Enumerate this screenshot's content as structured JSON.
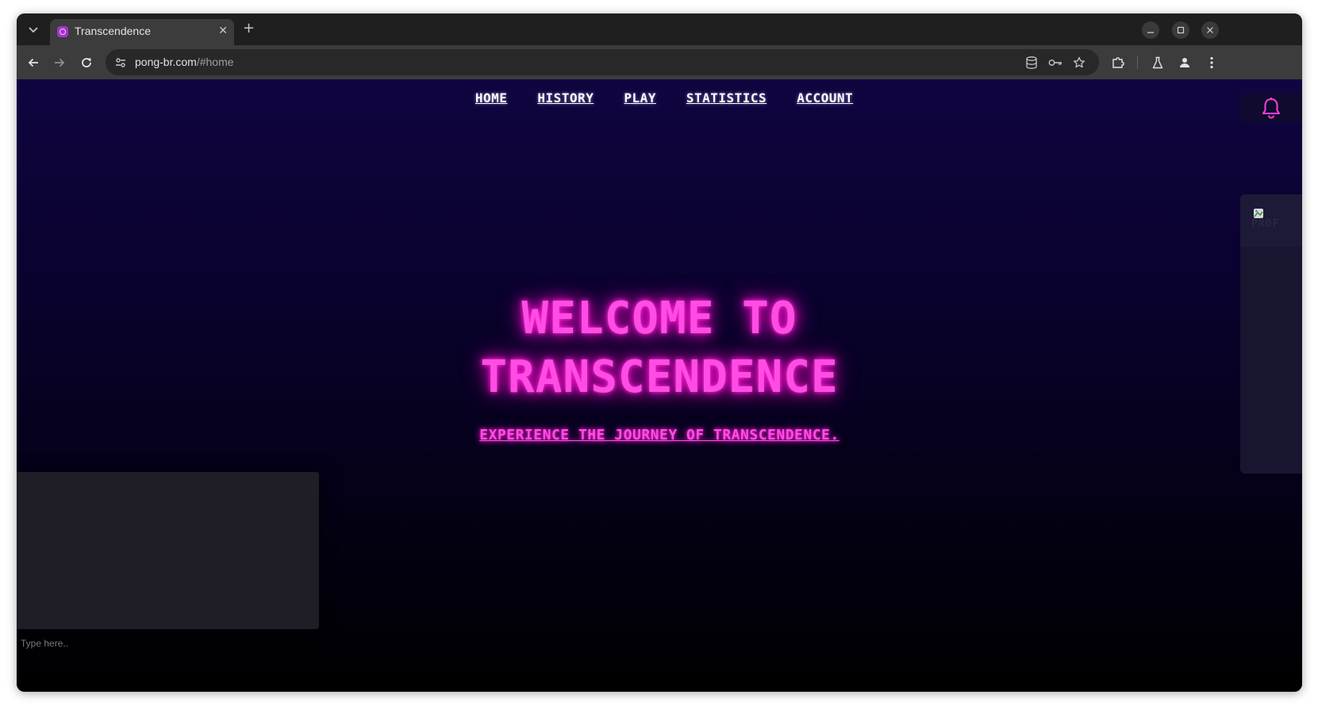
{
  "browser": {
    "tab": {
      "title": "Transcendence",
      "close_label": "✕"
    },
    "new_tab_label": "+",
    "url_host": "pong-br.com",
    "url_path": "/#home"
  },
  "nav": {
    "items": [
      {
        "label": "HOME"
      },
      {
        "label": "HISTORY"
      },
      {
        "label": "PLAY"
      },
      {
        "label": "STATISTICS"
      },
      {
        "label": "ACCOUNT"
      }
    ]
  },
  "hero": {
    "title_line1": "WELCOME TO",
    "title_line2": "TRANSCENDENCE",
    "subtitle": "EXPERIENCE THE JOURNEY OF TRANSCENDENCE."
  },
  "sidebar": {
    "avatar_alt": "PROF"
  },
  "chat": {
    "placeholder": "Type here.."
  },
  "colors": {
    "accent_neon": "#ff4de4",
    "bell": "#ff3fd8",
    "page_top": "#100540",
    "page_bottom": "#000000"
  },
  "icons": {
    "notification": "bell-icon",
    "tab_list": "chevron-down-icon",
    "back": "arrow-left-icon",
    "forward": "arrow-right-icon",
    "reload": "reload-icon",
    "site_info": "tune-icon",
    "storage": "database-icon",
    "password": "key-icon",
    "bookmark": "star-icon",
    "extensions": "puzzle-icon",
    "labs": "flask-icon",
    "profile": "person-icon",
    "menu": "kebab-menu-icon"
  }
}
